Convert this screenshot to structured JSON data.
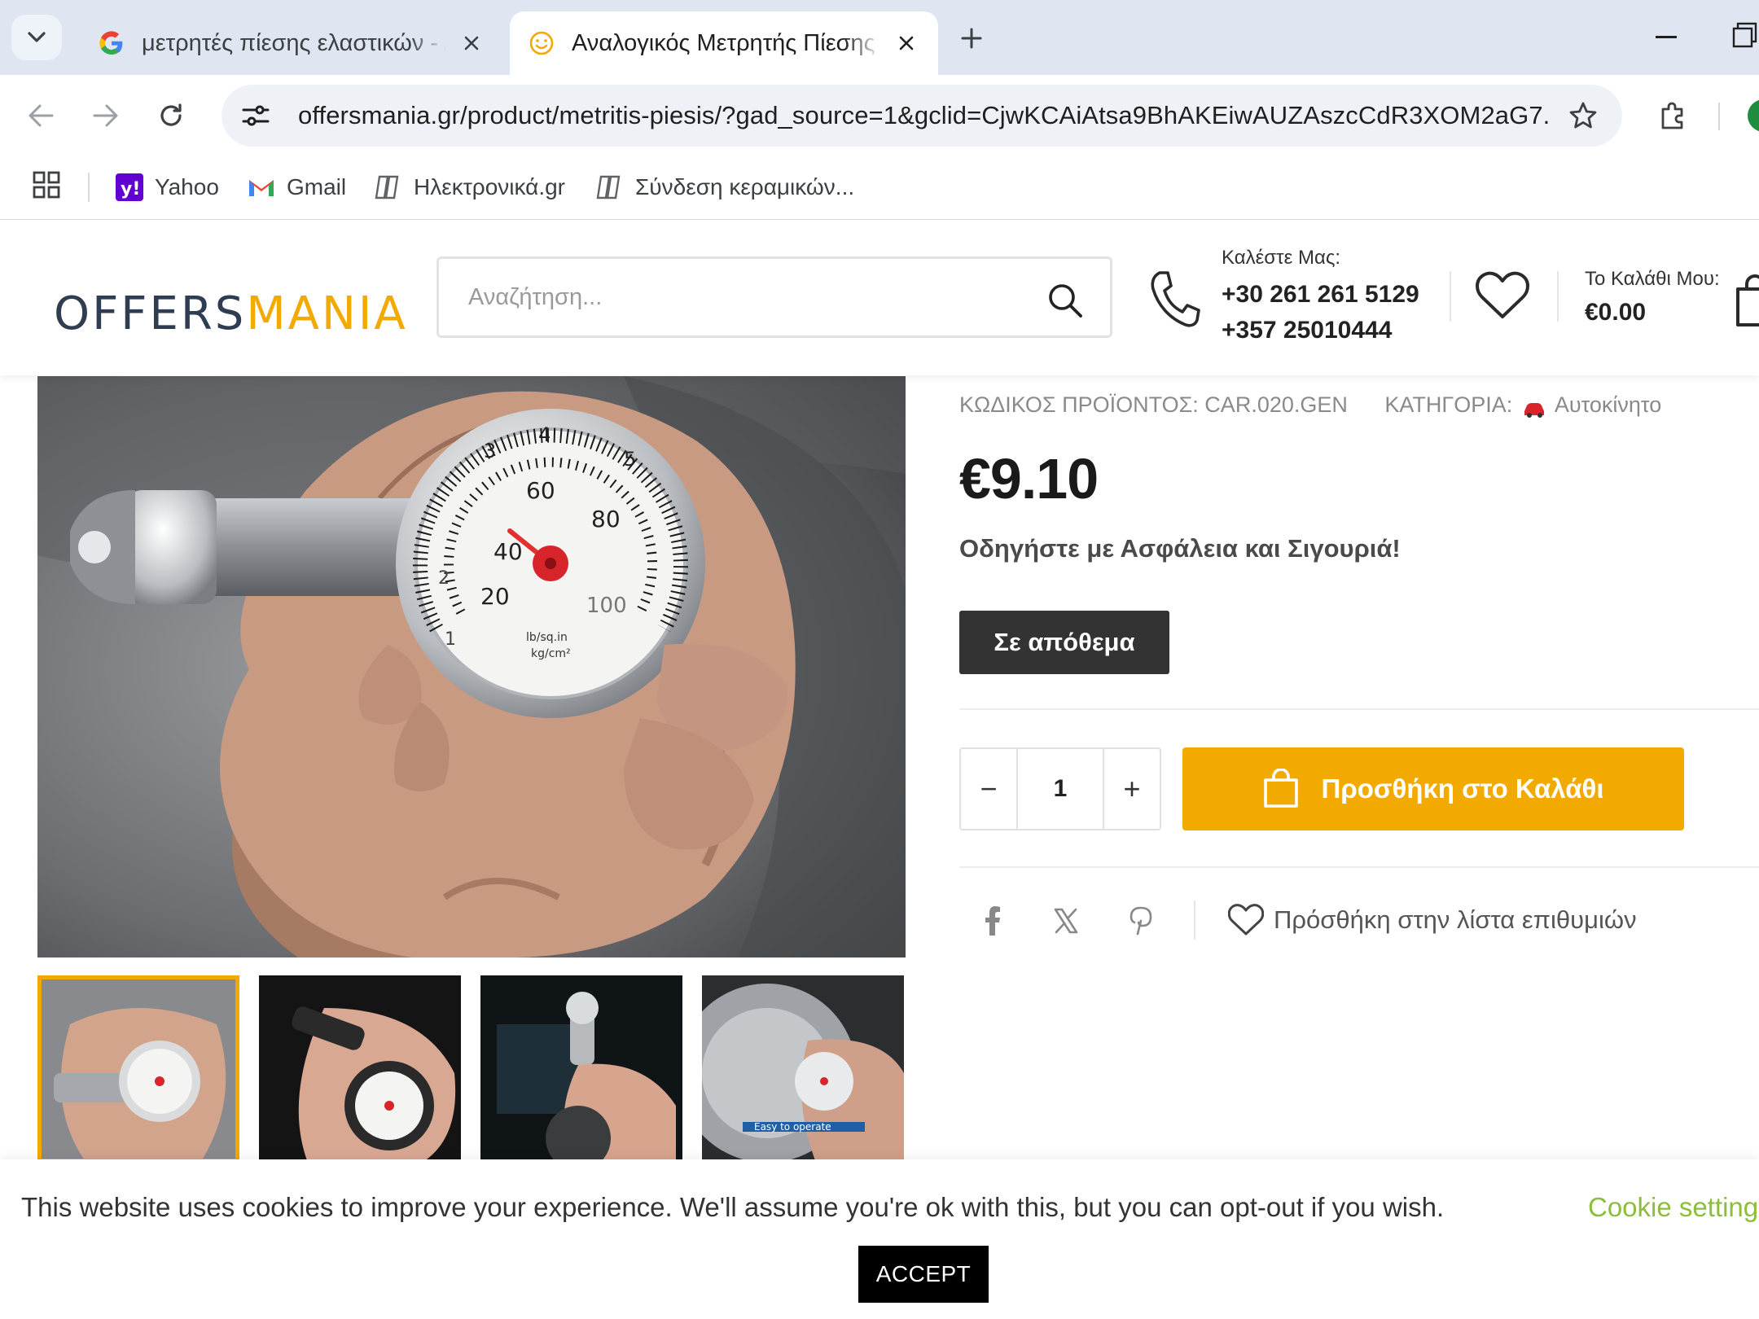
{
  "browser": {
    "tabs": [
      {
        "title": "μετρητές πίεσης ελαστικών - Α",
        "favicon": "google-icon"
      },
      {
        "title": "Αναλογικός Μετρητής Πίεσης Ε",
        "favicon": "smiley-icon"
      }
    ],
    "url": "offersmania.gr/product/metritis-piesis/?gad_source=1&gclid=CjwKCAiAtsa9BhAKEiwAUZAszcCdR3XOM2aG7...",
    "bookmarks": [
      {
        "label": "Yahoo",
        "icon": "yahoo-icon"
      },
      {
        "label": "Gmail",
        "icon": "gmail-icon"
      },
      {
        "label": "Ηλεκτρονικά.gr",
        "icon": "site-icon"
      },
      {
        "label": "Σύνδεση κεραμικών...",
        "icon": "site-icon"
      }
    ]
  },
  "header": {
    "logo_part1": "OFFERS",
    "logo_part2": "MANIA",
    "search_placeholder": "Αναζήτηση...",
    "call_label": "Καλέστε Μας:",
    "phone1": "+30 261 261 5129",
    "phone2": "+357 25010444",
    "cart_label": "Το Καλάθι Μου:",
    "cart_total": "€0.00"
  },
  "product": {
    "sku_label": "ΚΩΔΙΚΟΣ ΠΡΟΪΟΝΤΟΣ: CAR.020.GEN",
    "category_label": "ΚΑΤΗΓΟΡΙΑ:",
    "category_value": "Αυτοκίνητο",
    "price": "€9.10",
    "tagline": "Οδηγήστε με Ασφάλεια και Σιγουριά!",
    "stock": "Σε απόθεμα",
    "quantity": "1",
    "minus": "−",
    "plus": "+",
    "add_to_cart": "Προσθήκη στο Καλάθι",
    "wishlist": "Πρόσθήκη στην λίστα επιθυμιών",
    "thumb_caption": "Easy to operate",
    "gauge": {
      "label1": "lb/sq.in",
      "label2": "kg/cm²"
    }
  },
  "cookie": {
    "text": "This website uses cookies to improve your experience. We'll assume you're ok with this, but you can opt-out if you wish.",
    "settings": "Cookie settings",
    "accept": "ACCEPT"
  },
  "colors": {
    "accent": "#f2a900",
    "logo_dark": "#2f3d52",
    "cookie_link": "#8dbd3c"
  }
}
